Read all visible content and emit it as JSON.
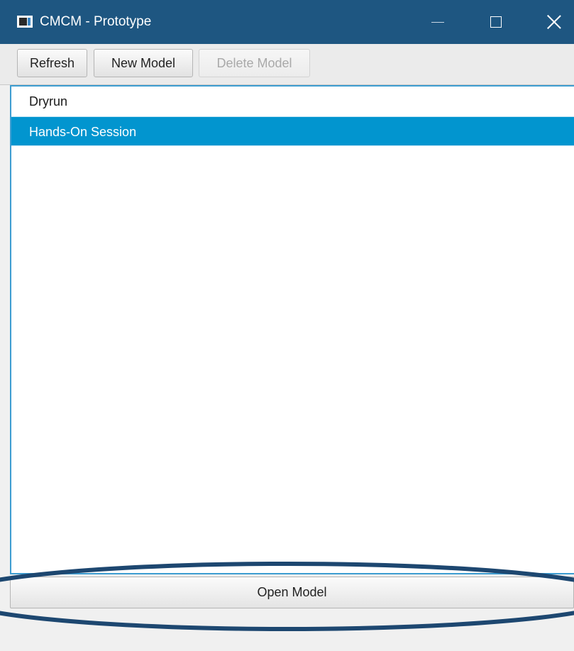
{
  "window": {
    "title": "CMCM - Prototype",
    "icon": "app-window-icon",
    "controls": [
      "minimize-icon",
      "maximize-icon",
      "close-icon"
    ]
  },
  "toolbar": {
    "refresh_label": "Refresh",
    "new_model_label": "New Model",
    "delete_model_label": "Delete Model",
    "delete_model_enabled": false
  },
  "model_list": {
    "items": [
      {
        "label": "Dryrun",
        "selected": false
      },
      {
        "label": "Hands-On Session",
        "selected": true
      }
    ]
  },
  "footer": {
    "open_model_label": "Open Model"
  },
  "colors": {
    "titlebar": "#1e5681",
    "selection": "#0295cf",
    "annotation_ellipse": "#1d4770"
  }
}
